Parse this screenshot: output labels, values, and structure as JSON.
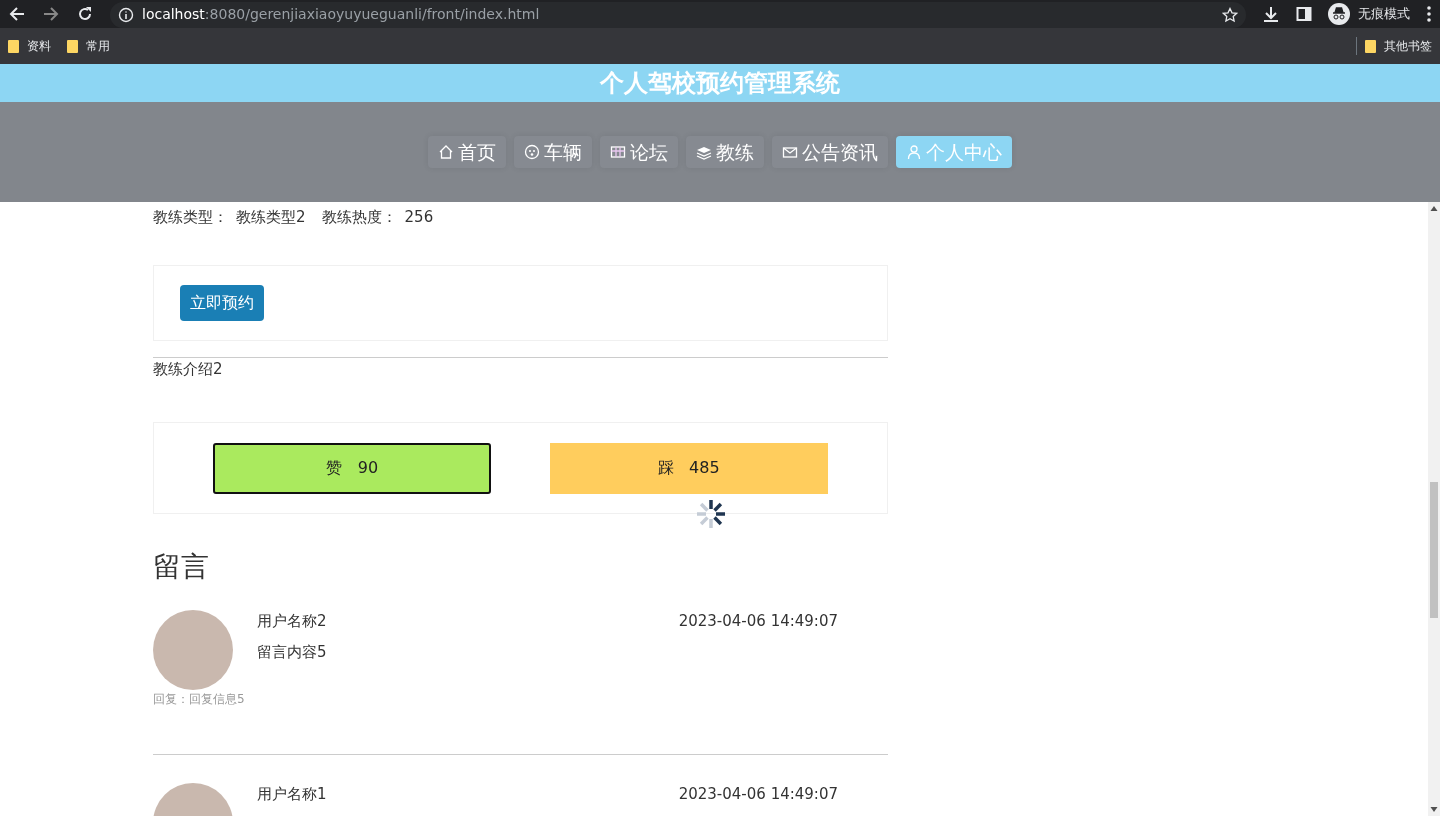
{
  "browser": {
    "url_host": "localhost",
    "url_path": ":8080/gerenjiaxiaoyuyueguanli/front/index.html",
    "profile": "无痕模式",
    "bookmarks": [
      "资料",
      "常用"
    ],
    "other_bookmarks": "其他书签"
  },
  "site": {
    "title": "个人驾校预约管理系统"
  },
  "nav": [
    {
      "label": "首页",
      "kind": "home",
      "selected": false
    },
    {
      "label": "车辆",
      "kind": "car",
      "selected": false
    },
    {
      "label": "论坛",
      "kind": "forum",
      "selected": false
    },
    {
      "label": "教练",
      "kind": "coach",
      "selected": false
    },
    {
      "label": "公告资讯",
      "kind": "mail",
      "selected": false
    },
    {
      "label": "个人中心",
      "kind": "user",
      "selected": true
    }
  ],
  "coach": {
    "fields": [
      {
        "label": "教练类型：",
        "value": "教练类型2"
      },
      {
        "label": "教练热度：",
        "value": "256"
      }
    ],
    "book_button": "立即预约",
    "intro": "教练介绍2",
    "votes": [
      {
        "kind": "like",
        "label": "赞",
        "count": "90",
        "focused": true
      },
      {
        "kind": "dislike",
        "label": "踩",
        "count": "485",
        "focused": false
      }
    ]
  },
  "comments": {
    "title": "留言",
    "items": [
      {
        "user": "用户名称2",
        "time": "2023-04-06 14:49:07",
        "content": "留言内容5",
        "reply": "回复：回复信息5"
      },
      {
        "user": "用户名称1",
        "time": "2023-04-06 14:49:07"
      }
    ]
  }
}
